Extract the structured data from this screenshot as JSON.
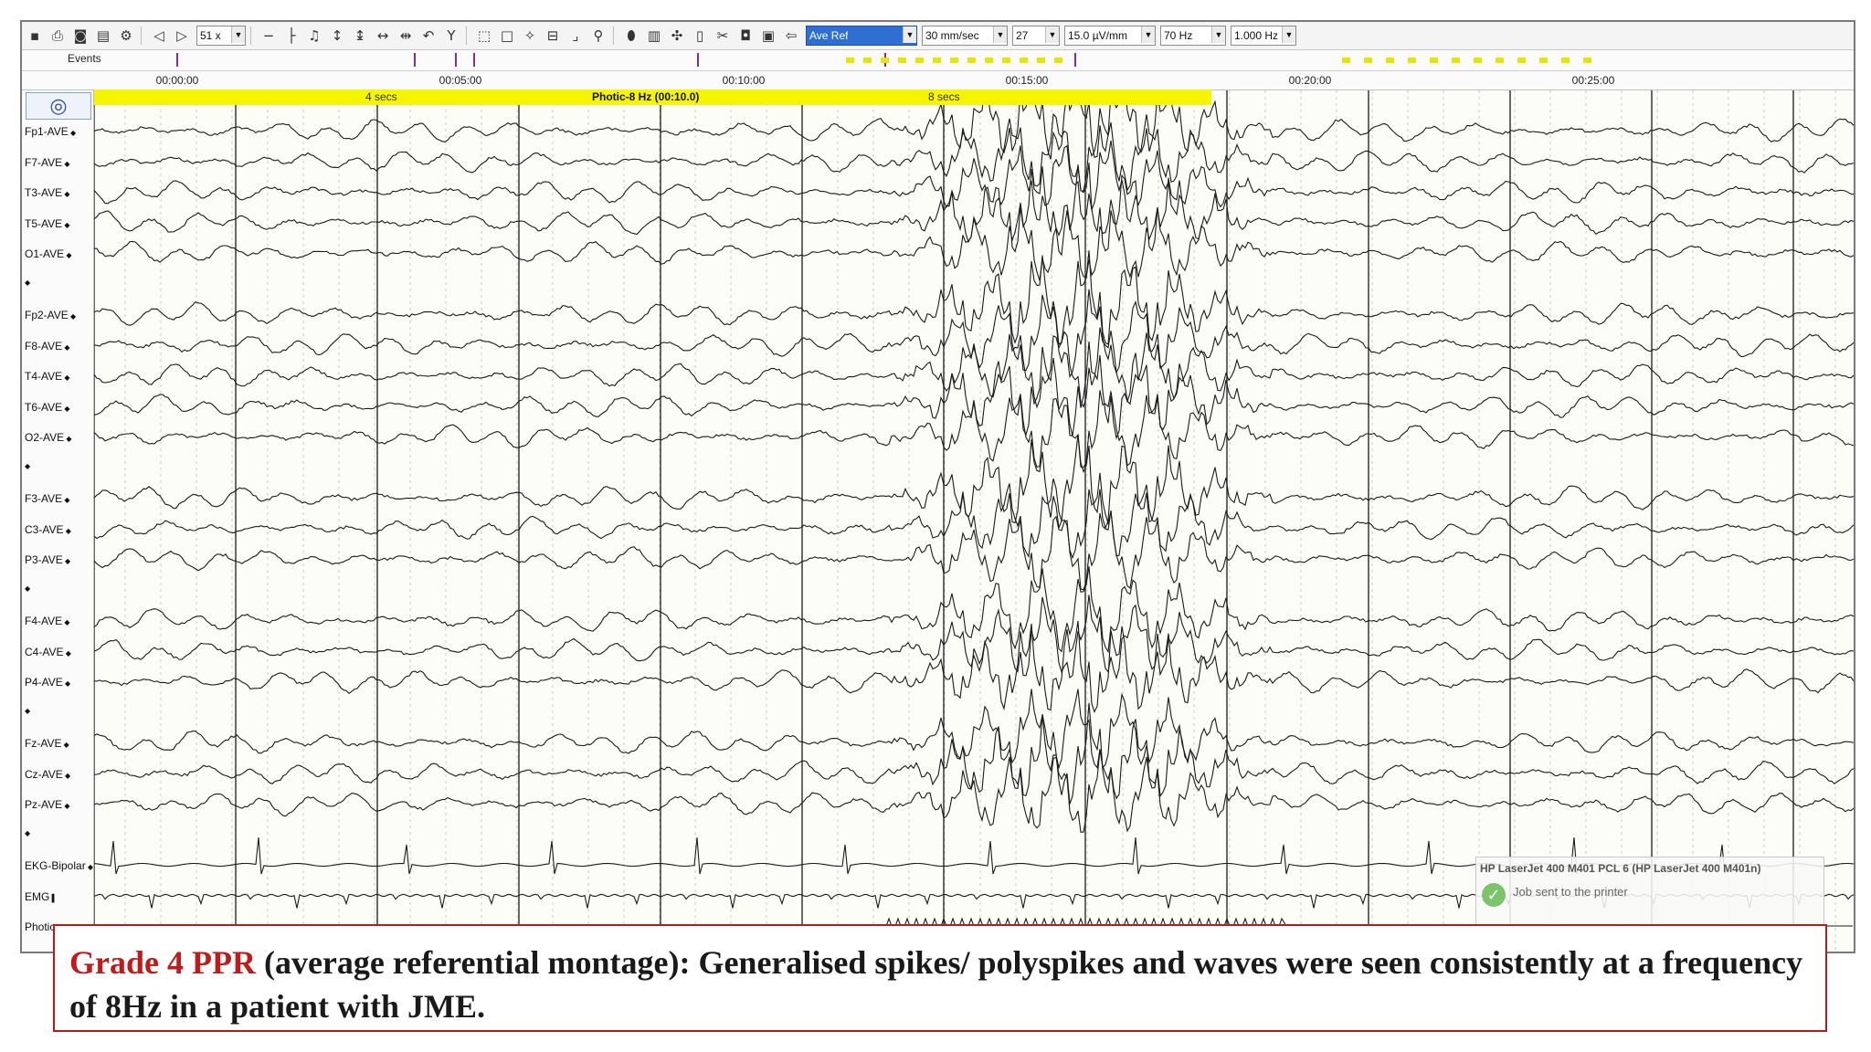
{
  "toolbar": {
    "zoom": "51 x",
    "montage": "Ave Ref",
    "speed": "30 mm/sec",
    "channels": "27",
    "sensitivity": "15.0 µV/mm",
    "hf_filter": "70 Hz",
    "lf_filter": "1.000 Hz",
    "icons": [
      "save-icon",
      "print-icon",
      "camera-icon",
      "delete-icon",
      "settings-icon",
      "prev-icon",
      "next-icon",
      "minus-icon",
      "baseline-icon",
      "music-icon",
      "scale-icon",
      "scale-icon",
      "arrows-icon",
      "undo-icon",
      "filter-icon",
      "select-icon",
      "rect-icon",
      "cursor-icon",
      "measure-icon",
      "corner-icon",
      "zoom-icon",
      "tag-icon",
      "tools-icon",
      "wrench-icon",
      "phone-icon",
      "scissors-icon",
      "camera-icon",
      "window-icon",
      "back-icon"
    ]
  },
  "events": {
    "label": "Events"
  },
  "timeline": {
    "ticks": [
      "00:00:00",
      "00:05:00",
      "00:10:00",
      "00:15:00",
      "00:20:00",
      "00:25:00"
    ]
  },
  "photic": {
    "label_left": "4 secs",
    "label_main": "Photic-8 Hz (00:10.0)",
    "label_right": "8 secs"
  },
  "channels": [
    "Fp1-AVE",
    "F7-AVE",
    "T3-AVE",
    "T5-AVE",
    "O1-AVE",
    "",
    "Fp2-AVE",
    "F8-AVE",
    "T4-AVE",
    "T6-AVE",
    "O2-AVE",
    "",
    "F3-AVE",
    "C3-AVE",
    "P3-AVE",
    "",
    "F4-AVE",
    "C4-AVE",
    "P4-AVE",
    "",
    "Fz-AVE",
    "Cz-AVE",
    "Pz-AVE",
    "",
    "EKG-Bipolar",
    "EMG",
    "Photic"
  ],
  "printer": {
    "title": "HP LaserJet 400 M401 PCL 6 (HP LaserJet 400 M401n)",
    "message": "Job sent to the printer"
  },
  "caption": {
    "highlight": "Grade 4 PPR",
    "text": " (average referential montage): Generalised spikes/ polyspikes and waves were seen consistently at a frequency of 8Hz in a patient with JME."
  },
  "colors": {
    "photic_bar": "#f5f500",
    "caption_highlight": "#c01a1a",
    "caption_border": "#b61c1c",
    "events_marker": "#7a2fa8"
  }
}
